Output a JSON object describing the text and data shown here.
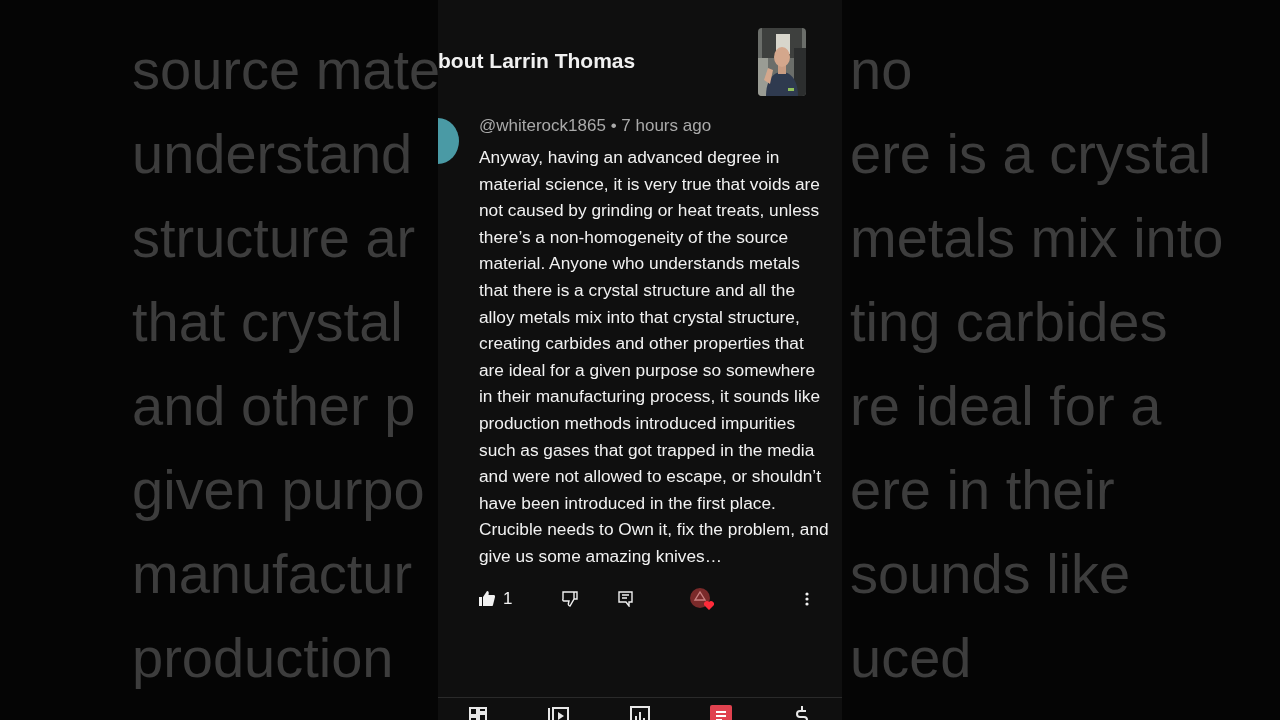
{
  "backdrop_left": [
    "source mate",
    "understand",
    "structure ar",
    "that crystal",
    "and other p",
    "given purpo",
    "manufactur",
    "production"
  ],
  "backdrop_right": [
    "no",
    "ere is a crystal",
    "metals mix into",
    "ting carbides",
    "re ideal for a",
    "ere in their",
    "sounds like",
    "uced"
  ],
  "header": {
    "title": "bout Larrin Thomas"
  },
  "comment": {
    "author": "@whiterock1865",
    "time": "• 7 hours ago",
    "text": "Anyway, having an advanced degree in material science, it is very true that voids are not caused by grinding or heat treats, unless there’s a non-homogeneity of the source material. Anyone who understands metals that there is a crystal structure and all the alloy metals mix into that crystal structure, creating carbides and other properties that are ideal for a given purpose so somewhere in their manufacturing process, it sounds like production methods introduced impurities such as gases that got trapped in the media and were not allowed to escape, or shouldn’t have been introduced in the first place.  Crucible needs to Own it, fix the problem, and give us some amazing knives…",
    "likes": "1",
    "creator_hearted": true
  },
  "bottom_nav": [
    {
      "kind": "content",
      "selected": false
    },
    {
      "kind": "videos",
      "selected": false
    },
    {
      "kind": "analytics",
      "selected": false
    },
    {
      "kind": "comments",
      "selected": true
    },
    {
      "kind": "earn",
      "selected": false
    }
  ]
}
